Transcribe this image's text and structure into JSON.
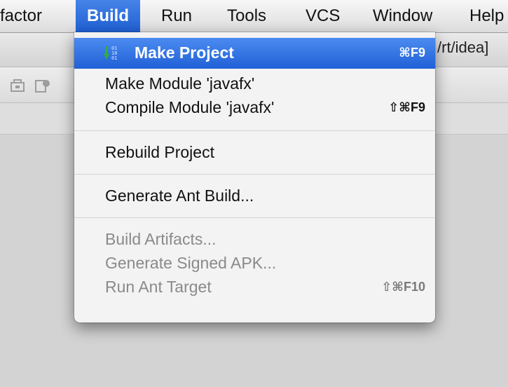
{
  "menubar": {
    "items": [
      {
        "label": "factor"
      },
      {
        "label": "Build"
      },
      {
        "label": "Run"
      },
      {
        "label": "Tools"
      },
      {
        "label": "VCS"
      },
      {
        "label": "Window"
      },
      {
        "label": "Help"
      }
    ]
  },
  "pathbar": {
    "text": "/rt/idea]"
  },
  "toolbar": {
    "icons": [
      "archive-icon",
      "structure-icon"
    ]
  },
  "build_menu": {
    "items": [
      {
        "label": "Make Project",
        "shortcut": "⌘F9",
        "enabled": true,
        "highlighted": true,
        "icon": "make-project-icon"
      },
      {
        "label": "Make Module 'javafx'",
        "shortcut": "",
        "enabled": true
      },
      {
        "label": "Compile Module 'javafx'",
        "shortcut": "⇧⌘F9",
        "enabled": true
      },
      {
        "label": "Rebuild Project",
        "shortcut": "",
        "enabled": true
      },
      {
        "label": "Generate Ant Build...",
        "shortcut": "",
        "enabled": true
      },
      {
        "label": "Build Artifacts...",
        "shortcut": "",
        "enabled": false
      },
      {
        "label": "Generate Signed APK...",
        "shortcut": "",
        "enabled": false
      },
      {
        "label": "Run Ant Target",
        "shortcut": "⇧⌘F10",
        "enabled": false
      }
    ]
  },
  "colors": {
    "highlight": "#2a6ad6",
    "disabled_text": "#8a8a8a",
    "make_icon_green": "#2fae3a"
  }
}
